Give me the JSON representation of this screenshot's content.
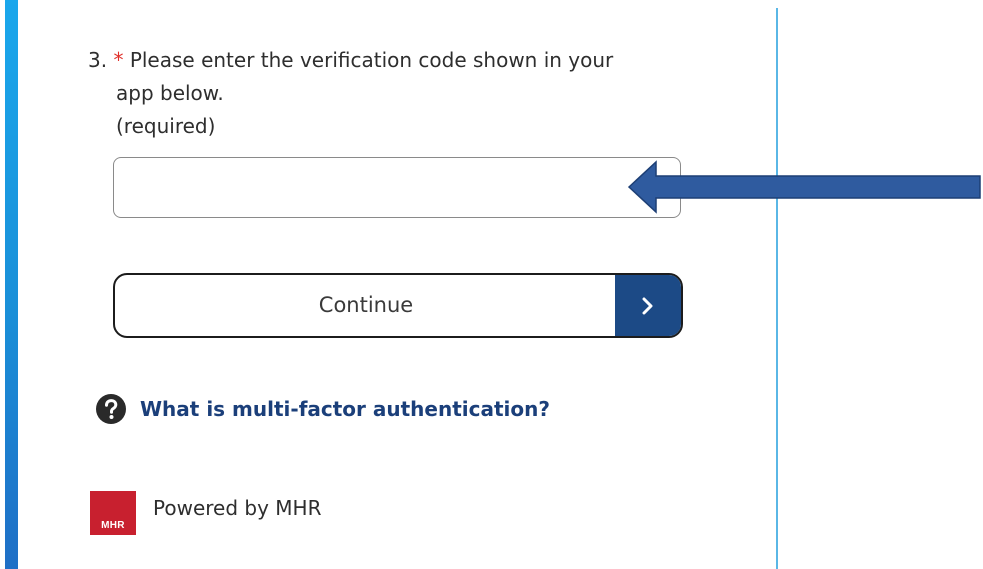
{
  "question": {
    "number": "3.",
    "required_marker": "*",
    "text_line1": "Please enter the verification code shown in your",
    "text_line2": "app below.",
    "required_note": "(required)"
  },
  "code_input": {
    "value": "",
    "placeholder": ""
  },
  "continue_button": {
    "label": "Continue",
    "icon": "chevron-right-icon"
  },
  "help": {
    "icon": "question-circle-icon",
    "link_text": "What is multi-factor authentication?"
  },
  "footer": {
    "logo_text": "MHR",
    "powered_by": "Powered by MHR"
  },
  "annotation": {
    "icon": "left-arrow-annotation",
    "color": "#2f5b9f"
  },
  "colors": {
    "accent_bar": "#1a8fd8",
    "button_arrow_bg": "#1c4a86",
    "link": "#1b3f7a",
    "required": "#e0302a",
    "brand_logo": "#c8202f"
  }
}
